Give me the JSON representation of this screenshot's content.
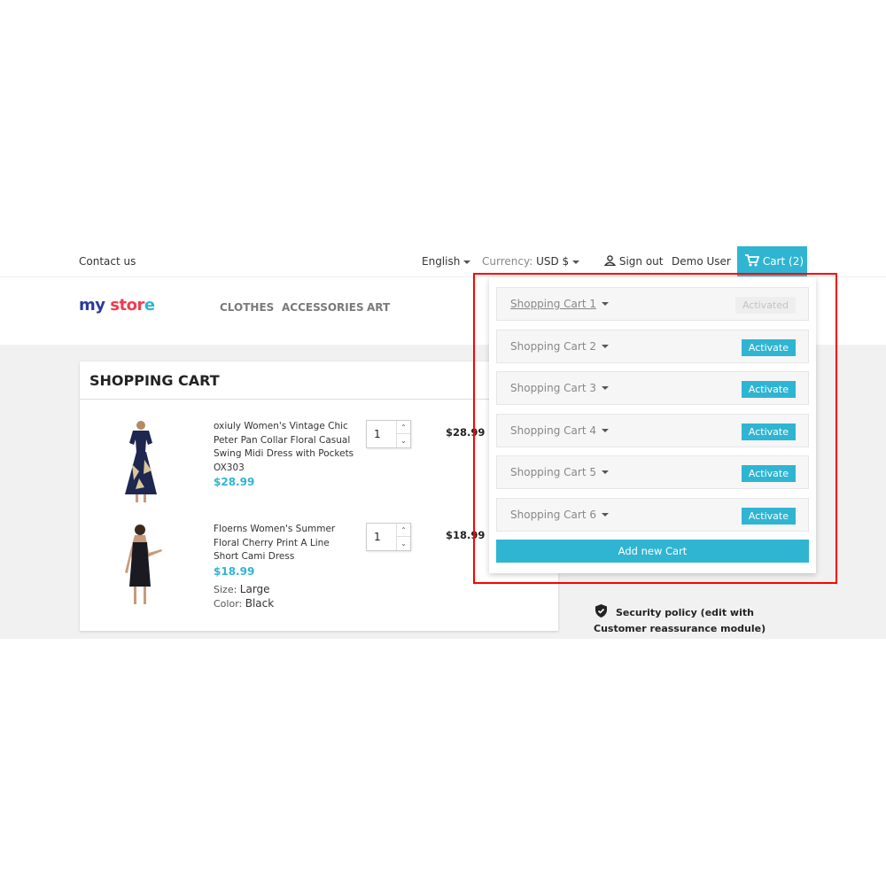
{
  "header": {
    "contact": "Contact us",
    "language": "English",
    "currency_label": "Currency:",
    "currency": "USD $",
    "sign_out": "Sign out",
    "user": "Demo User",
    "cart": "Cart (2)"
  },
  "logo": {
    "text": "my store"
  },
  "menu": [
    "CLOTHES",
    "ACCESSORIES",
    "ART"
  ],
  "cart": {
    "title": "SHOPPING CART",
    "items": [
      {
        "name": "oxiuly Women's Vintage Chic Peter Pan Collar Floral Casual Swing Midi Dress with Pockets OX303",
        "price": "$28.99",
        "qty": "1",
        "total": "$28.99"
      },
      {
        "name": "Floerns Women's Summer Floral Cherry Print A Line Short Cami Dress",
        "price": "$18.99",
        "qty": "1",
        "total": "$18.99",
        "size_label": "Size:",
        "size": "Large",
        "color_label": "Color:",
        "color": "Black"
      }
    ]
  },
  "dropdown": {
    "carts": [
      {
        "label": "Shopping Cart 1",
        "button": "Activated",
        "active": true
      },
      {
        "label": "Shopping Cart 2",
        "button": "Activate"
      },
      {
        "label": "Shopping Cart 3",
        "button": "Activate"
      },
      {
        "label": "Shopping Cart 4",
        "button": "Activate"
      },
      {
        "label": "Shopping Cart 5",
        "button": "Activate"
      },
      {
        "label": "Shopping Cart 6",
        "button": "Activate"
      }
    ],
    "add": "Add new Cart"
  },
  "reassurance": {
    "text": "Security policy (edit with Customer reassurance module)"
  },
  "colors": {
    "accent": "#2fb5d2",
    "highlight": "#ff0000"
  }
}
